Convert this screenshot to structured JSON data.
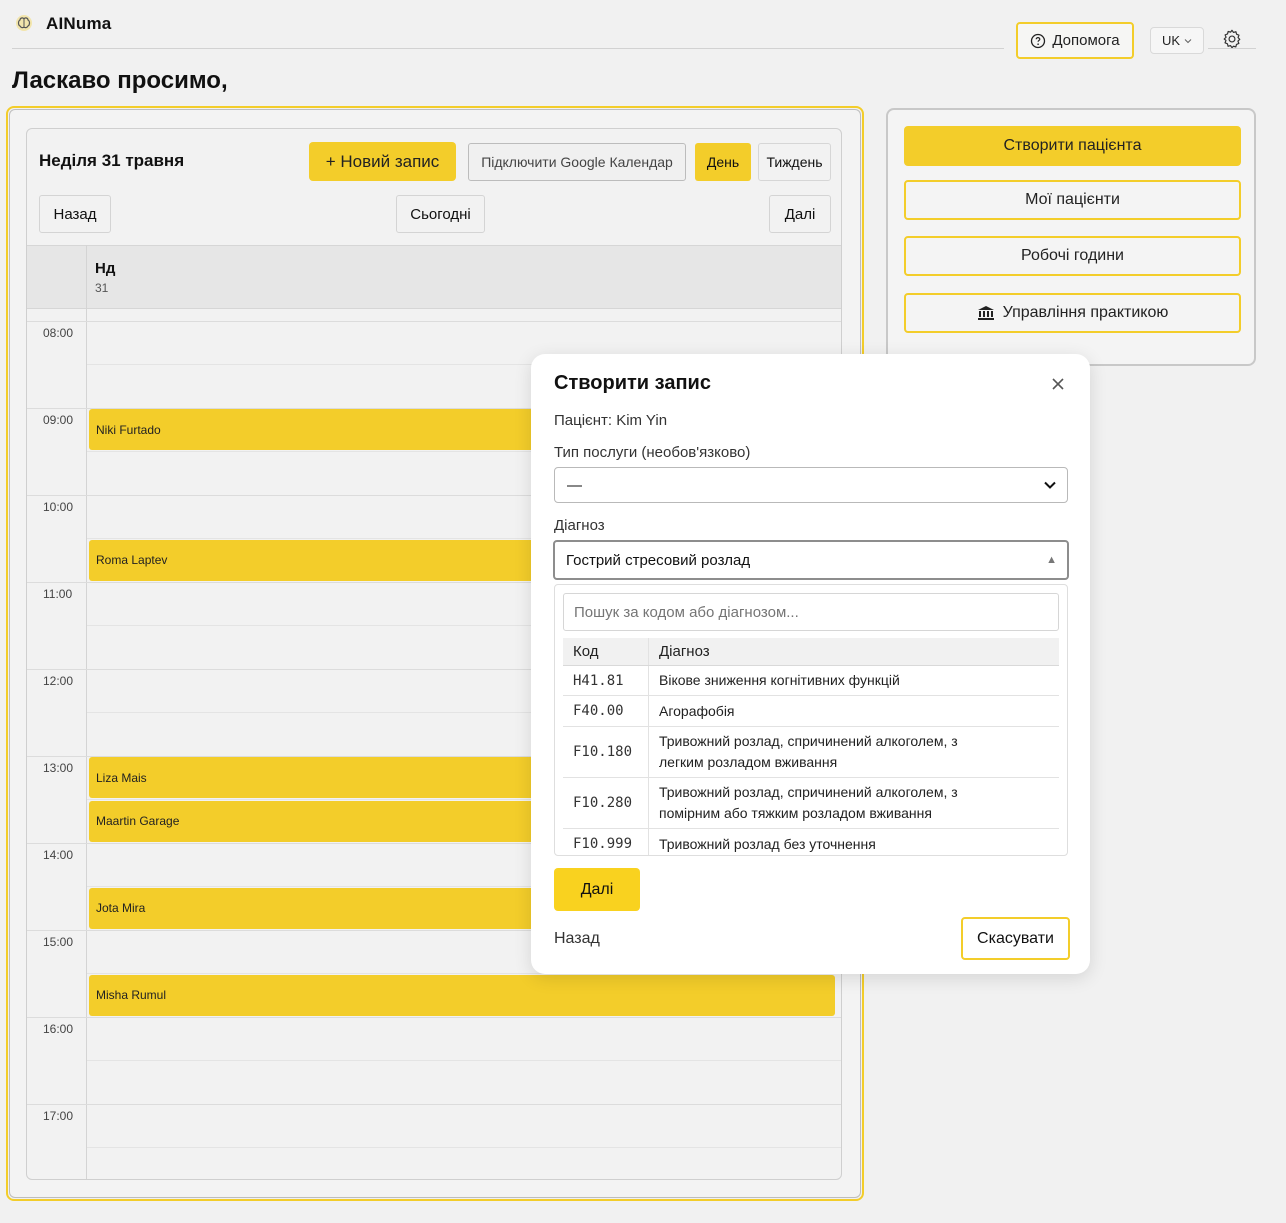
{
  "app": {
    "name": "AINuma"
  },
  "header": {
    "help_label": "Допомога",
    "language": "UK",
    "welcome": "Ласкаво просимо,"
  },
  "calendar": {
    "date_title": "Неділя 31 травня",
    "new_entry_label": "+ Новий запис",
    "google_label": "Підключити Google Календар",
    "day_label": "День",
    "week_label": "Тиждень",
    "back_label": "Назад",
    "today_label": "Сьогодні",
    "next_label": "Далі",
    "day_name": "Нд",
    "day_number": "31",
    "hours": [
      "08:00",
      "09:00",
      "10:00",
      "11:00",
      "12:00",
      "13:00",
      "14:00",
      "15:00",
      "16:00",
      "17:00"
    ],
    "events": [
      {
        "name": "Niki Furtado",
        "start": "09:00"
      },
      {
        "name": "Roma Laptev",
        "start": "10:30"
      },
      {
        "name": "Liza Mais",
        "start": "13:00"
      },
      {
        "name": "Maartin Garage",
        "start": "13:30"
      },
      {
        "name": "Jota Mira",
        "start": "14:30"
      },
      {
        "name": "Misha Rumul",
        "start": "15:30"
      }
    ]
  },
  "right_panel": {
    "create_patient": "Створити пацієнта",
    "my_patients": "Мої пацієнти",
    "working_hours": "Робочі години",
    "practice_management": "Управління практикою"
  },
  "modal": {
    "title": "Створити запис",
    "patient_line": "Пацієнт: Kim Yin",
    "service_label": "Тип послуги (необов'язково)",
    "service_value": "—",
    "diagnosis_label": "Діагноз",
    "diagnosis_value": "Гострий стресовий розлад",
    "search_placeholder": "Пошук за кодом або діагнозом...",
    "table_headers": {
      "code": "Код",
      "diagnosis": "Діагноз"
    },
    "rows": [
      {
        "code": "H41.81",
        "diagnosis": "Вікове зниження когнітивних функцій"
      },
      {
        "code": "F40.00",
        "diagnosis": "Агорафобія"
      },
      {
        "code": "F10.180",
        "diagnosis": "Тривожний розлад, спричинений алкоголем, з легким розладом вживання"
      },
      {
        "code": "F10.280",
        "diagnosis": "Тривожний розлад, спричинений алкоголем, з помірним або тяжким розладом вживання"
      },
      {
        "code": "F10.999",
        "diagnosis": "Тривожний розлад без уточнення"
      }
    ],
    "next_label": "Далі",
    "back_label": "Назад",
    "cancel_label": "Скасувати"
  },
  "colors": {
    "accent": "#f3cd2a",
    "background": "#f1f1f1"
  },
  "icons": [
    "brain-logo-icon",
    "help-circle-icon",
    "chevron-down-icon",
    "settings-gear-icon",
    "bank-icon",
    "close-icon",
    "triangle-up-icon"
  ]
}
